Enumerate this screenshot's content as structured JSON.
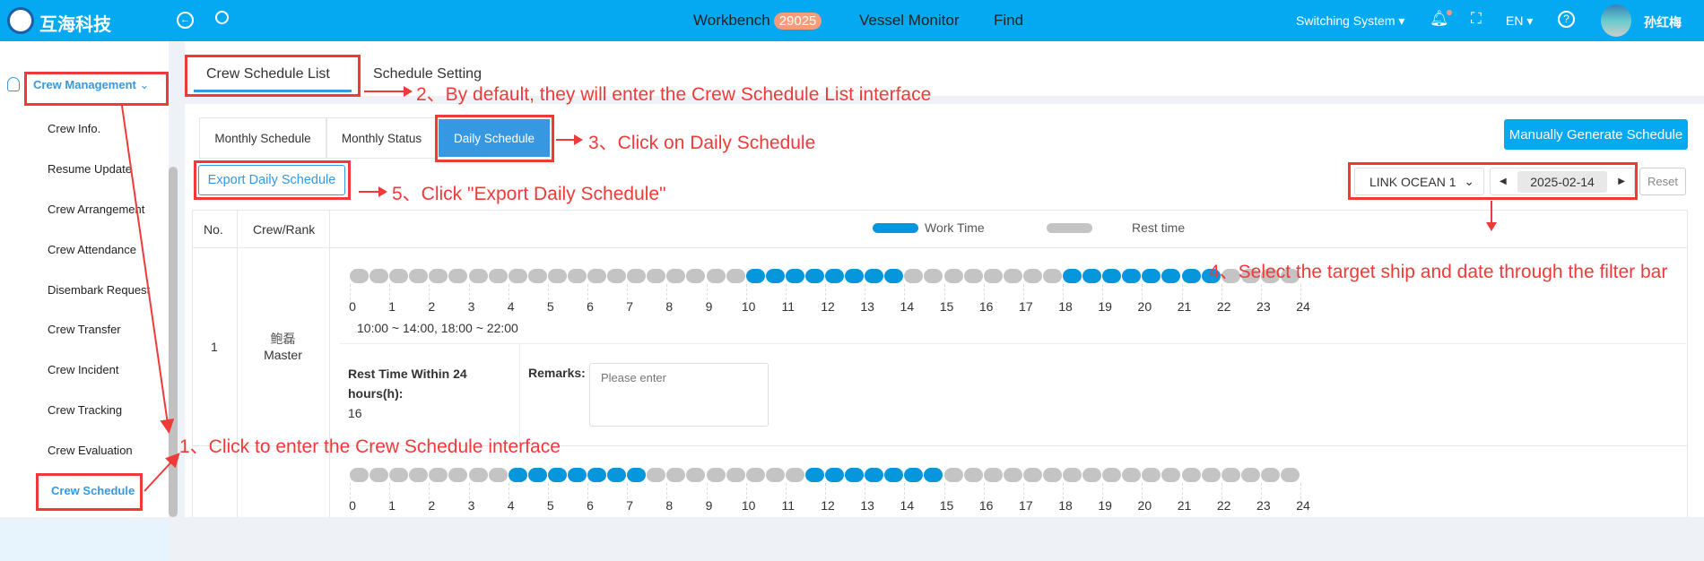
{
  "header": {
    "logo_text": "互海科技",
    "nav": [
      {
        "label": "Workbench",
        "badge": "29025"
      },
      {
        "label": "Vessel Monitor"
      },
      {
        "label": "Find"
      }
    ],
    "switching": "Switching System",
    "lang": "EN",
    "user": "孙红梅",
    "icons": [
      "back-icon",
      "search-icon",
      "bell-icon",
      "fullscreen-icon",
      "help-icon"
    ]
  },
  "sidebar": {
    "group": "Crew Management",
    "items": [
      "Crew Info.",
      "Resume Update",
      "Crew Arrangement",
      "Crew Attendance",
      "Disembark Request",
      "Crew Transfer",
      "Crew Incident",
      "Crew Tracking",
      "Crew Evaluation",
      "Crew Schedule"
    ],
    "active": "Crew Schedule"
  },
  "tabs": [
    "Crew Schedule List",
    "Schedule Setting"
  ],
  "subtabs": [
    "Monthly Schedule",
    "Monthly Status",
    "Daily Schedule"
  ],
  "buttons": {
    "generate": "Manually Generate Schedule",
    "export": "Export Daily Schedule",
    "reset": "Reset"
  },
  "filter": {
    "ship": "LINK OCEAN 1",
    "date": "2025-02-14"
  },
  "table": {
    "headers": [
      "No.",
      "Crew/Rank"
    ],
    "legend": {
      "work": "Work Time",
      "rest": "Rest time"
    },
    "rows": [
      {
        "no": "1",
        "name": "鲍磊",
        "rank": "Master",
        "work_intervals": [
          [
            10,
            14
          ],
          [
            18,
            22
          ]
        ],
        "time_text": "10:00 ~ 14:00, 18:00 ~ 22:00",
        "rest_label": "Rest Time Within 24 hours(h):",
        "rest_value": "16",
        "remarks_label": "Remarks:",
        "remarks_placeholder": "Please enter"
      },
      {
        "work_intervals": [
          [
            4,
            7.5
          ],
          [
            11.5,
            15
          ]
        ]
      }
    ]
  },
  "colors": {
    "header": "#05a9f2",
    "work": "#0596dc",
    "rest": "#c4c4c4",
    "annotation": "#f03a3a",
    "active_tab": "#3598e0"
  },
  "annotations": {
    "a1": "1、Click to enter the Crew Schedule interface",
    "a2": "2、By default, they will enter the Crew Schedule List interface",
    "a3": "3、Click on Daily Schedule",
    "a4": "4、Select the target ship and date through the filter bar",
    "a5": "5、Click \"Export Daily Schedule\""
  }
}
